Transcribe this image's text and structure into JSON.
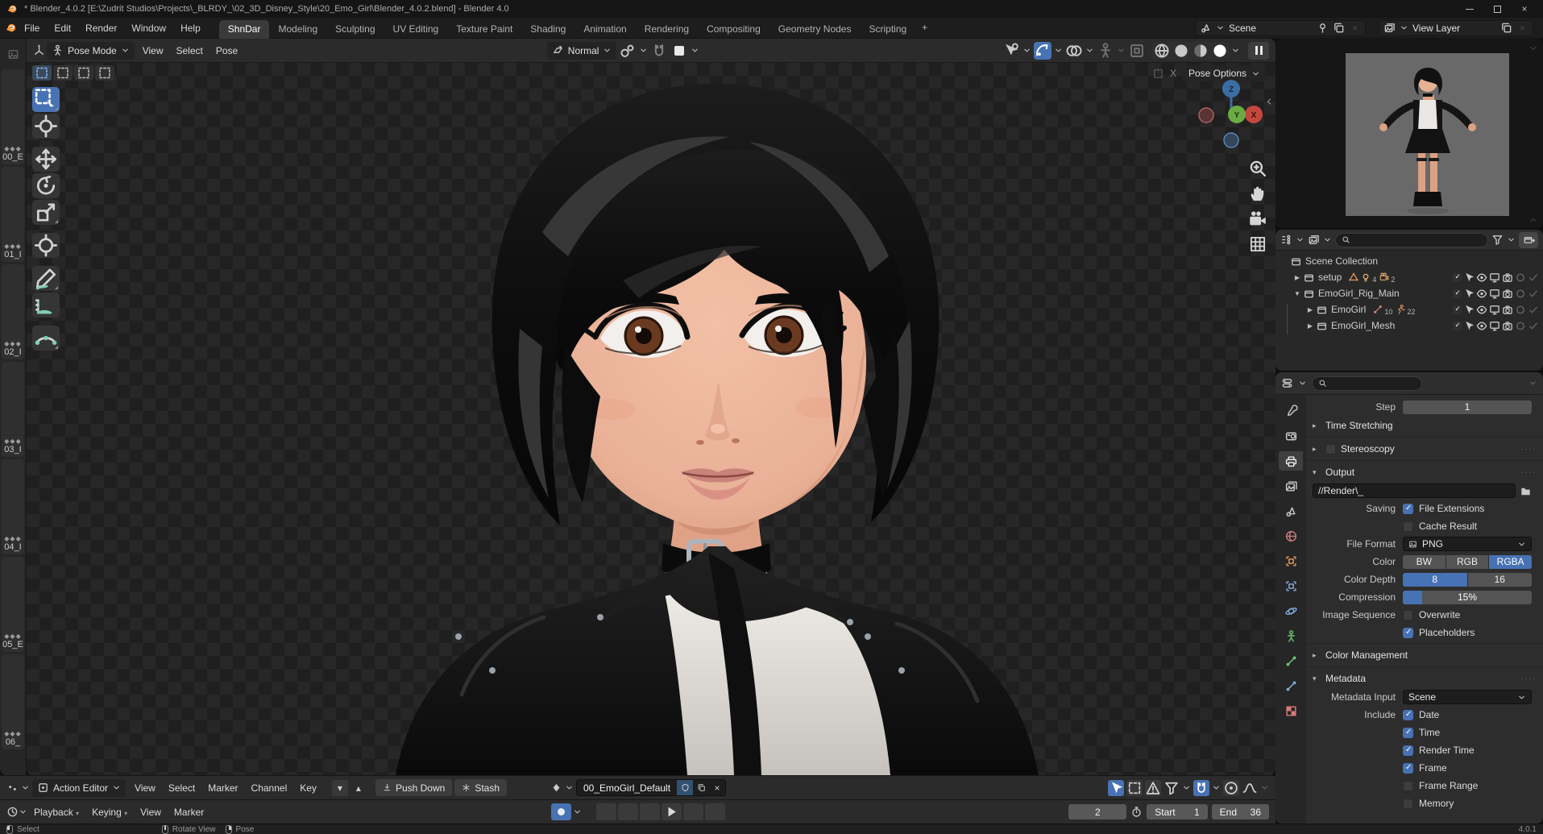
{
  "window": {
    "title": "* Blender_4.0.2 [E:\\Zudrit Studios\\Projects\\_BLRDY_\\02_3D_Disney_Style\\20_Emo_Girl\\Blender_4.0.2.blend] - Blender 4.0",
    "status_version": "4.0.1"
  },
  "topbar": {
    "menus": [
      "File",
      "Edit",
      "Render",
      "Window",
      "Help"
    ],
    "workspace_tabs": [
      "ShnDar",
      "Modeling",
      "Sculpting",
      "UV Editing",
      "Texture Paint",
      "Shading",
      "Animation",
      "Rendering",
      "Compositing",
      "Geometry Nodes",
      "Scripting"
    ],
    "active_tab": "ShnDar",
    "add_tab_label": "+",
    "scene_name": "Scene",
    "view_layer_name": "View Layer"
  },
  "viewport": {
    "mode": "Pose Mode",
    "menus": [
      "View",
      "Select",
      "Pose"
    ],
    "orientation": "Normal",
    "pose_options_label": "Pose Options",
    "overlay_close_label": "X",
    "axis_labels": {
      "x": "X",
      "y": "Y",
      "z": "Z"
    },
    "header_toggles": [
      {
        "icon": "viscursor",
        "name": "object-visibility",
        "active": false,
        "chev": true
      },
      {
        "icon": "gizmoarc",
        "name": "gizmos-toggle",
        "active": true,
        "chev": true
      },
      {
        "icon": "overlays",
        "name": "overlays-toggle",
        "active": false,
        "chev": true
      },
      {
        "icon": "xrayfig",
        "name": "xray-toggle",
        "active": false,
        "chev": true,
        "dim": true
      },
      {
        "icon": "renderpass",
        "name": "render-pass",
        "active": false,
        "chev": false,
        "dim": true
      }
    ],
    "shading_modes": [
      "wireframe",
      "solid",
      "material",
      "rendered"
    ],
    "shading_active": "rendered"
  },
  "left_strip": {
    "items": [
      "00_E",
      "01_I",
      "02_I",
      "03_I",
      "04_I",
      "05_E",
      "06_"
    ]
  },
  "toolbar": {
    "tools": [
      {
        "name": "select-box",
        "icon": "toolselect",
        "active": true,
        "corner": true,
        "group": false
      },
      {
        "name": "cursor",
        "icon": "toolcursor",
        "active": false,
        "corner": false,
        "group": false
      },
      {
        "name": "move",
        "icon": "toolmove",
        "active": false,
        "corner": false,
        "group": true
      },
      {
        "name": "rotate",
        "icon": "toolrotate",
        "active": false,
        "corner": false,
        "group": false
      },
      {
        "name": "scale",
        "icon": "toolscale",
        "active": false,
        "corner": true,
        "group": false
      },
      {
        "name": "transform",
        "icon": "tooltransform",
        "active": false,
        "corner": false,
        "group": true
      },
      {
        "name": "annotate",
        "icon": "toolannotate",
        "active": false,
        "corner": true,
        "group": true
      },
      {
        "name": "measure",
        "icon": "toolmeasure",
        "active": false,
        "corner": false,
        "group": false
      },
      {
        "name": "pose-breakdowner",
        "icon": "toolpose",
        "active": false,
        "corner": true,
        "group": true
      }
    ]
  },
  "outliner": {
    "rows": [
      {
        "name": "Scene Collection",
        "depth": 0,
        "expand": "none",
        "toggles": false,
        "badges": []
      },
      {
        "name": "setup",
        "depth": 1,
        "expand": "collapsed",
        "toggles": true,
        "badges": [
          {
            "icon": "meshdata",
            "count": ""
          },
          {
            "icon": "lightdata",
            "count": "4"
          },
          {
            "icon": "camdata",
            "count": "2"
          }
        ]
      },
      {
        "name": "EmoGirl_Rig_Main",
        "depth": 1,
        "expand": "expanded",
        "toggles": true,
        "badges": []
      },
      {
        "name": "EmoGirl",
        "depth": 2,
        "expand": "collapsed",
        "toggles": true,
        "badges": [
          {
            "icon": "bonedata",
            "count": "10"
          },
          {
            "icon": "posedata",
            "count": "22"
          }
        ]
      },
      {
        "name": "EmoGirl_Mesh",
        "depth": 2,
        "expand": "collapsed",
        "toggles": true,
        "badges": []
      }
    ]
  },
  "properties": {
    "tabs": [
      "tool",
      "render",
      "output",
      "view-layer",
      "scene",
      "world",
      "object",
      "constraints",
      "physics",
      "object-data",
      "bone",
      "bone-constraint",
      "texture"
    ],
    "active_tab": "output",
    "step_label": "Step",
    "step_value": "1",
    "sections": {
      "time_stretching": "Time Stretching",
      "stereoscopy": "Stereoscopy",
      "output": "Output",
      "color_management": "Color Management",
      "metadata": "Metadata"
    },
    "output": {
      "path": "//Render\\_",
      "saving_label": "Saving",
      "file_extensions": {
        "label": "File Extensions",
        "checked": true
      },
      "cache_result": {
        "label": "Cache Result",
        "checked": false
      },
      "file_format_label": "File Format",
      "file_format": "PNG",
      "color_label": "Color",
      "color_options": [
        "BW",
        "RGB",
        "RGBA"
      ],
      "color_active": "RGBA",
      "color_depth_label": "Color Depth",
      "color_depth_options": [
        "8",
        "16"
      ],
      "color_depth_active": "8",
      "compression_label": "Compression",
      "compression_value": "15%",
      "compression_percent": 15,
      "image_sequence_label": "Image Sequence",
      "overwrite": {
        "label": "Overwrite",
        "checked": false
      },
      "placeholders": {
        "label": "Placeholders",
        "checked": true
      }
    },
    "metadata": {
      "input_label": "Metadata Input",
      "input_value": "Scene",
      "include_label": "Include",
      "items": [
        {
          "label": "Date",
          "checked": true
        },
        {
          "label": "Time",
          "checked": true
        },
        {
          "label": "Render Time",
          "checked": true
        },
        {
          "label": "Frame",
          "checked": true
        },
        {
          "label": "Frame Range",
          "checked": false
        },
        {
          "label": "Memory",
          "checked": false
        }
      ]
    }
  },
  "dope_sheet": {
    "editor_label": "Action Editor",
    "menus": [
      "View",
      "Select",
      "Marker",
      "Channel",
      "Key"
    ],
    "push_down_label": "Push Down",
    "stash_label": "Stash",
    "action_name": "00_EmoGirl_Default"
  },
  "timeline": {
    "playback_label": "Playback",
    "keying_label": "Keying",
    "menus": [
      "View",
      "Marker"
    ],
    "transport": [
      "jump-start",
      "prev-keyframe",
      "prev-frame",
      "play",
      "next-keyframe",
      "jump-end"
    ],
    "current_frame": "2",
    "start_label": "Start",
    "start_value": "1",
    "end_label": "End",
    "end_value": "36"
  },
  "status_bar": {
    "hints": [
      {
        "button": "left",
        "label": "Select"
      },
      {
        "button": "middle",
        "label": "Rotate View"
      },
      {
        "button": "right",
        "label": "Pose"
      }
    ]
  },
  "colors": {
    "accent_blue": "#4772b3",
    "axis_x": "#c4473d",
    "axis_y": "#6cab44",
    "axis_z": "#3b6fa3",
    "checker_dark": "#1f1f1f",
    "checker_light": "#272727"
  }
}
